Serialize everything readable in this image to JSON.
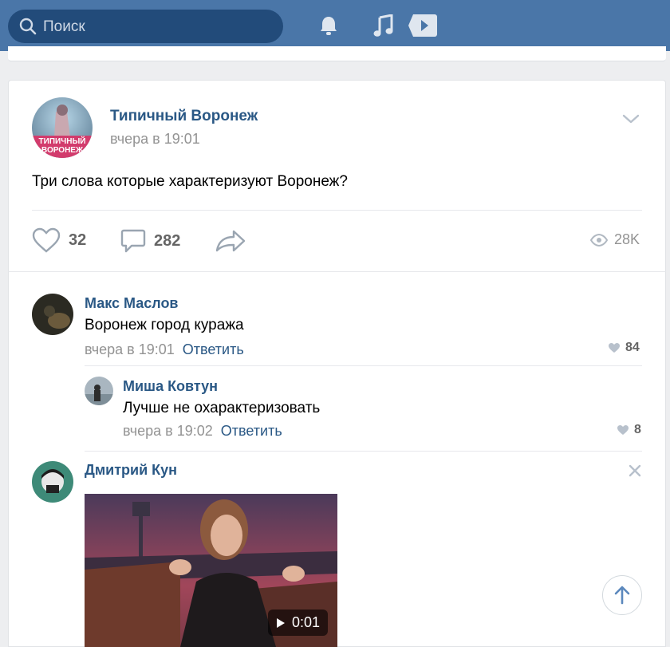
{
  "search": {
    "placeholder": "Поиск"
  },
  "header_icons": [
    "bell-icon",
    "music-icon",
    "video-play-icon"
  ],
  "post": {
    "author": "Типичный Воронеж",
    "avatar_text_line1": "ТИПИЧНЫЙ",
    "avatar_text_line2": "ВОРОНЕЖ",
    "time": "вчера в 19:01",
    "text": "Три слова которые характеризуют Воронеж?",
    "likes": "32",
    "comments": "282",
    "views": "28K"
  },
  "comments": [
    {
      "author": "Макс Маслов",
      "text": "Воронеж город куража",
      "time": "вчера в 19:01",
      "reply": "Ответить",
      "likes": "84"
    },
    {
      "author": "Миша Ковтун",
      "text": "Лучше не охарактеризовать",
      "time": "вчера в 19:02",
      "reply": "Ответить",
      "likes": "8"
    },
    {
      "author": "Дмитрий Кун",
      "video_duration": "0:01"
    }
  ],
  "colors": {
    "header": "#4a76a8",
    "link": "#2a5885",
    "muted": "#939393"
  }
}
